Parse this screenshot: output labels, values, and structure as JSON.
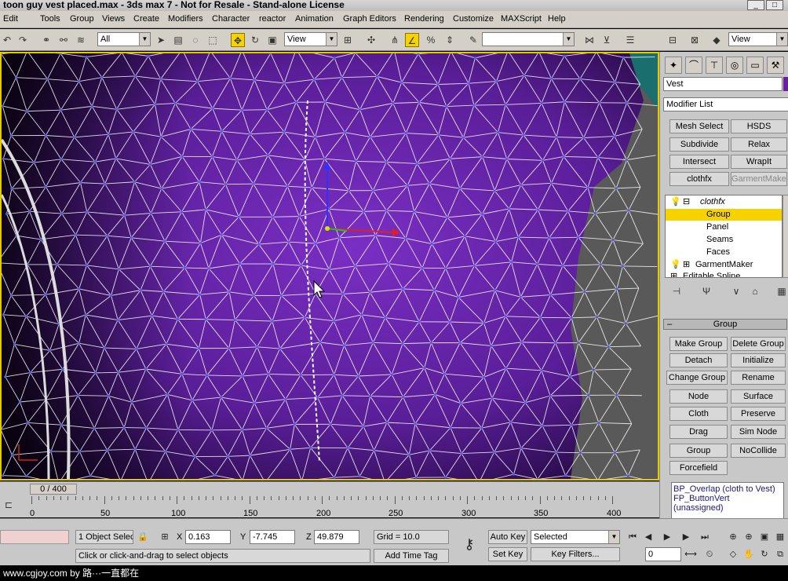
{
  "window": {
    "title": "toon guy vest placed.max - 3ds max 7 - Not for Resale - Stand-alone License",
    "minimize": "_",
    "maximize": "□"
  },
  "menu": [
    "Edit",
    "Tools",
    "Group",
    "Views",
    "Create",
    "Modifiers",
    "Character",
    "reactor",
    "Animation",
    "Graph Editors",
    "Rendering",
    "Customize",
    "MAXScript",
    "Help"
  ],
  "toolbar": {
    "selection_filter": "All",
    "ref_coord": "View",
    "named_selection": "",
    "view_dropdown": "View",
    "icons": [
      "undo-icon",
      "redo-icon",
      "link-icon",
      "unlink-icon",
      "bind-icon",
      "select-icon",
      "select-by-name-icon",
      "region-icon",
      "window-crossing-icon",
      "move-icon",
      "rotate-icon",
      "scale-icon",
      "pivot-icon",
      "select-manipulate-icon",
      "snap-toggle-icon",
      "angle-snap-icon",
      "percent-snap-icon",
      "spinner-snap-icon",
      "edit-named-sel-icon",
      "mirror-icon",
      "align-icon",
      "layer-icon",
      "curve-editor-icon",
      "schematic-icon",
      "material-editor-icon",
      "render-scene-icon"
    ]
  },
  "command_panel": {
    "object_name": "Vest",
    "object_color": "#6b1fa0",
    "modifier_list": "Modifier List",
    "modifier_buttons": [
      {
        "label": "Mesh Select",
        "disabled": false
      },
      {
        "label": "HSDS",
        "disabled": false
      },
      {
        "label": "Subdivide",
        "disabled": false
      },
      {
        "label": "Relax",
        "disabled": false
      },
      {
        "label": "Intersect",
        "disabled": false
      },
      {
        "label": "WrapIt",
        "disabled": false
      },
      {
        "label": "clothfx",
        "disabled": false
      },
      {
        "label": "GarmentMaker",
        "disabled": true
      }
    ],
    "stack": [
      {
        "label": "clothfx",
        "indent": 0,
        "selected": false,
        "italic": true,
        "prefix": "⊟"
      },
      {
        "label": "Group",
        "indent": 1,
        "selected": true,
        "italic": false,
        "prefix": ""
      },
      {
        "label": "Panel",
        "indent": 1,
        "selected": false,
        "italic": false,
        "prefix": ""
      },
      {
        "label": "Seams",
        "indent": 1,
        "selected": false,
        "italic": false,
        "prefix": ""
      },
      {
        "label": "Faces",
        "indent": 1,
        "selected": false,
        "italic": false,
        "prefix": ""
      },
      {
        "label": "GarmentMaker",
        "indent": 0,
        "selected": false,
        "italic": false,
        "prefix": "⊞"
      },
      {
        "label": "Editable Spline",
        "indent": 0,
        "selected": false,
        "italic": false,
        "prefix": "⊞"
      }
    ],
    "rollout_title": "Group",
    "group_buttons": [
      "Make Group",
      "Delete Group",
      "Detach",
      "Initialize",
      "Change Group",
      "Rename",
      "Node",
      "Surface",
      "Cloth",
      "Preserve",
      "Drag",
      "Sim Node",
      "Group",
      "NoCollide",
      "Forcefield"
    ],
    "info_lines": [
      "BP_Overlap (cloth to Vest)",
      "FP_ButtonVert (unassigned)"
    ]
  },
  "timeline": {
    "slider": "0 / 400",
    "labels": [
      "0",
      "50",
      "100",
      "150",
      "200",
      "250",
      "300",
      "350",
      "400"
    ]
  },
  "status": {
    "selection": "1 Object Selec",
    "x_label": "X",
    "x_value": "0.163",
    "y_label": "Y",
    "y_value": "-7.745",
    "z_label": "Z",
    "z_value": "49.879",
    "grid": "Grid = 10.0",
    "prompt": "Click or click-and-drag to select objects",
    "add_time_tag": "Add Time Tag",
    "auto_key": "Auto Key",
    "set_key": "Set Key",
    "selected_dropdown": "Selected",
    "key_filters": "Key Filters...",
    "frame": "0"
  },
  "footer": "www.cgjoy.com by 路···一直都在"
}
